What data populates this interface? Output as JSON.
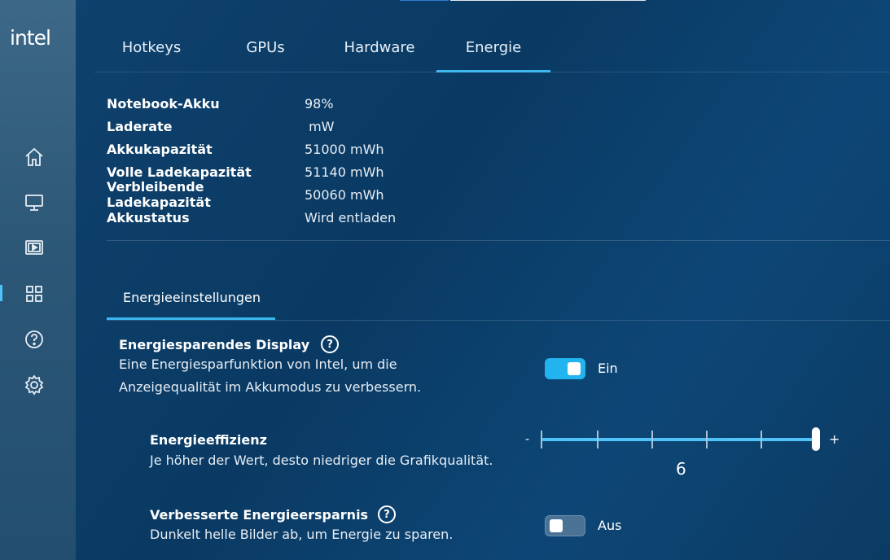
{
  "app": {
    "logo": "intel"
  },
  "sidebar": {
    "items": [
      {
        "icon": "home-icon"
      },
      {
        "icon": "display-icon"
      },
      {
        "icon": "video-icon"
      },
      {
        "icon": "apps-grid-icon",
        "active": true
      },
      {
        "icon": "help-icon"
      },
      {
        "icon": "gear-icon"
      }
    ]
  },
  "tabs": [
    {
      "label": "Hotkeys"
    },
    {
      "label": "GPUs"
    },
    {
      "label": "Hardware"
    },
    {
      "label": "Energie",
      "active": true
    }
  ],
  "battery_info": [
    {
      "label": "Notebook-Akku",
      "value": "98%"
    },
    {
      "label": "Laderate",
      "value": " mW"
    },
    {
      "label": "Akkukapazität",
      "value": "51000 mWh"
    },
    {
      "label": "Volle Ladekapazität",
      "value": "51140 mWh"
    },
    {
      "label": "Verbleibende Ladekapazität",
      "value": "50060 mWh"
    },
    {
      "label": "Akkustatus",
      "value": "Wird entladen"
    }
  ],
  "subtab": {
    "label": "Energieeinstellungen"
  },
  "settings": {
    "display_saving": {
      "title": "Energiesparendes Display",
      "desc_line1": "Eine Energiesparfunktion von Intel, um die",
      "desc_line2": "Anzeigequalität im Akkumodus zu verbessern.",
      "toggle_state": "on",
      "toggle_label": "Ein"
    },
    "efficiency": {
      "title": "Energieeffizienz",
      "desc": "Je höher der Wert, desto niedriger die Grafikqualität.",
      "min_label": "-",
      "max_label": "+",
      "value": "6",
      "min": 1,
      "max": 6
    },
    "enhanced_saving": {
      "title": "Verbesserte Energieersparnis",
      "desc": "Dunkelt helle Bilder ab, um Energie zu sparen.",
      "toggle_state": "off",
      "toggle_label": "Aus"
    }
  },
  "colors": {
    "accent": "#3ab7ee",
    "background": "#0b3d68",
    "sidebar": "#2c5777"
  }
}
